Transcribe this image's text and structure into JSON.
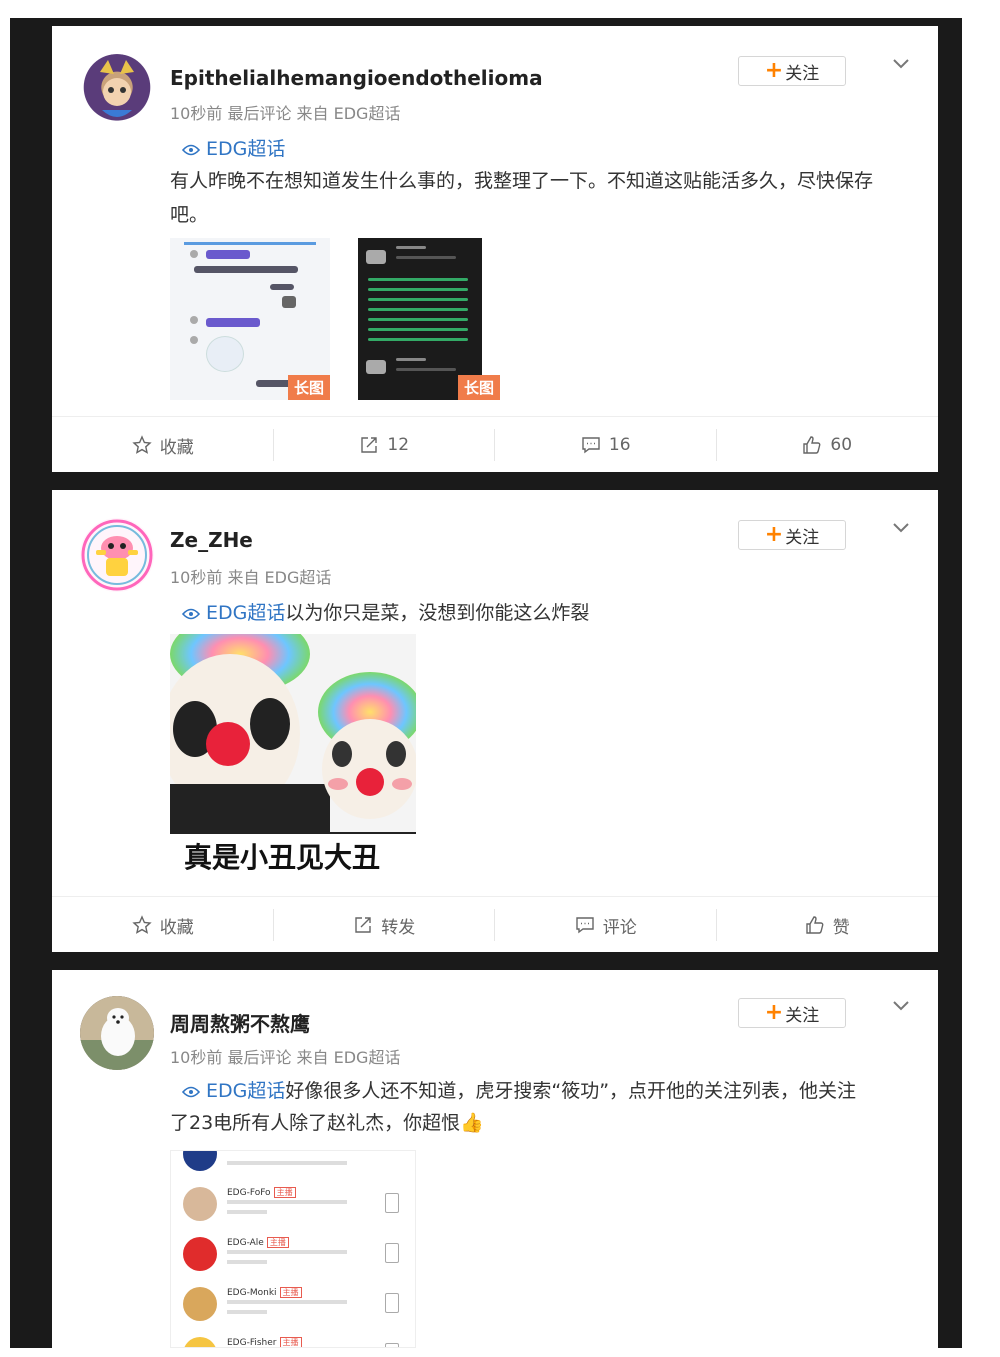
{
  "posts": [
    {
      "username": "Epithelialhemangioendothelioma",
      "meta": "10秒前 最后评论 来自 EDG超话",
      "follow_label": "关注",
      "topic": "EDG超话",
      "text": "有人昨晚不在想知道发生什么事的，我整理了一下。不知道这贴能活多久，尽快保存吧。",
      "image_tags": [
        "长图",
        "长图"
      ],
      "actions": {
        "favorite": "收藏",
        "repost": "12",
        "comment": "16",
        "like": "60"
      }
    },
    {
      "username": "Ze_ZHe",
      "meta": "10秒前 来自 EDG超话",
      "follow_label": "关注",
      "topic": "EDG超话",
      "text": "以为你只是菜，没想到你能这么炸裂",
      "meme_caption": "真是小丑见大丑",
      "actions": {
        "favorite": "收藏",
        "repost": "转发",
        "comment": "评论",
        "like": "赞"
      }
    },
    {
      "username": "周周熬粥不熬鹰",
      "meta": "10秒前 最后评论 来自 EDG超话",
      "follow_label": "关注",
      "topic": "EDG超话",
      "text_line1": "好像很多人还不知道，虎牙搜索“筱功”，点开他的关注列表，他关注",
      "text_line2": "了23电所有人除了赵礼杰，你超恨👍",
      "follow_list": [
        {
          "name": "EDG-FoFo",
          "tag": "主播"
        },
        {
          "name": "EDG-Ale",
          "tag": "主播"
        },
        {
          "name": "EDG-Monki",
          "tag": "主播"
        },
        {
          "name": "EDG-Fisher",
          "tag": "主播"
        }
      ]
    }
  ],
  "colors": {
    "accent": "#ff8200",
    "topic": "#3075c4",
    "tag": "#f07c4a"
  }
}
